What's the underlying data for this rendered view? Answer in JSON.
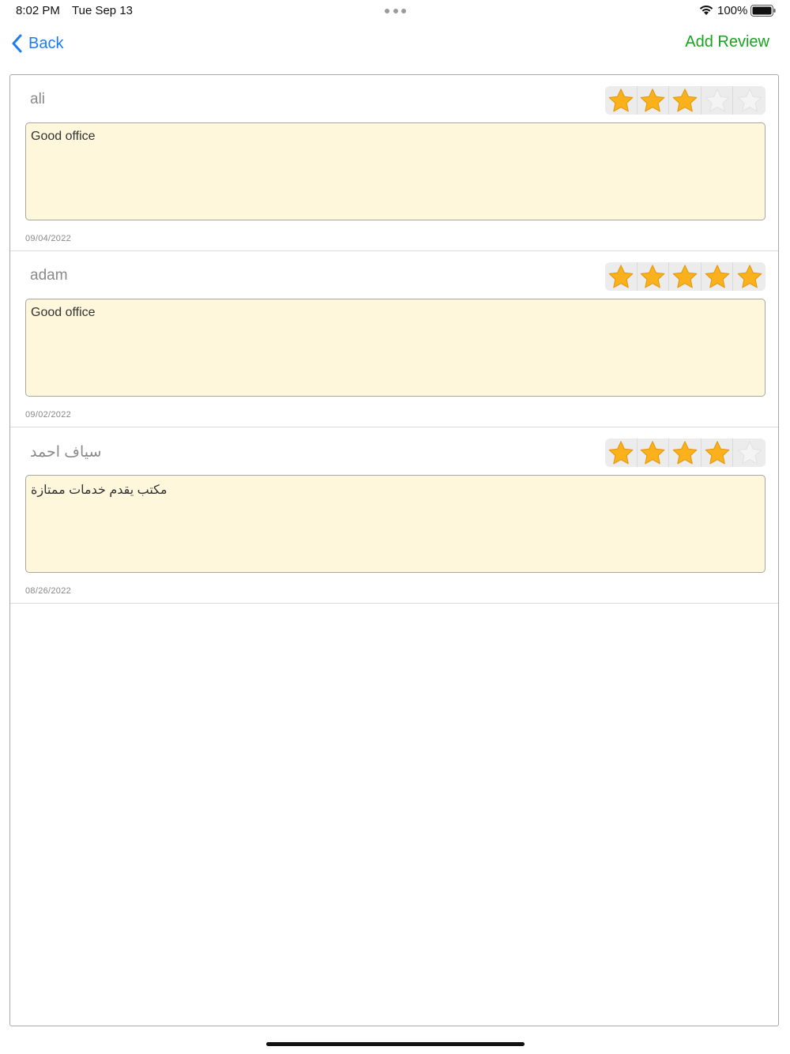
{
  "status_bar": {
    "time": "8:02 PM",
    "date": "Tue Sep 13",
    "battery": "100%"
  },
  "nav": {
    "back_label": "Back",
    "add_review_label": "Add Review"
  },
  "colors": {
    "back": "#1e7cf2",
    "add_review": "#1aa321",
    "star_filled": "#fbb11b",
    "star_empty": "#f4f4f4",
    "review_box": "#fef7dc"
  },
  "reviews": [
    {
      "name": "ali",
      "rating": 3,
      "max_rating": 5,
      "text": "Good office",
      "date": "09/04/2022"
    },
    {
      "name": "adam",
      "rating": 5,
      "max_rating": 5,
      "text": "Good office",
      "date": "09/02/2022"
    },
    {
      "name": "سياف احمد",
      "rating": 4,
      "max_rating": 5,
      "text": "مكتب يقدم خدمات ممتازة",
      "date": "08/26/2022"
    }
  ]
}
